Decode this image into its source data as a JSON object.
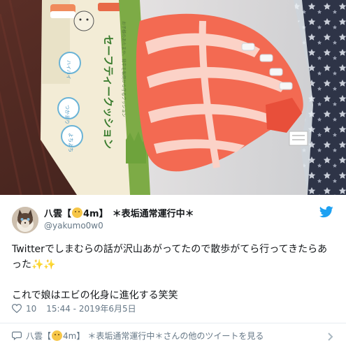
{
  "tweet": {
    "author_name_prefix": "八雲【",
    "author_name_mid": "4m】",
    "author_name_suffix": "＊表垢通常運行中＊",
    "author_handle": "@yakumo0w0",
    "body_line1": "Twitterでしまむらの話が沢山あがってたので散歩がてら行ってきたらあった",
    "body_sparkles": "✨✨",
    "body_line2": "これで娘はエビの化身に進化する笑笑",
    "likes": "10",
    "timestamp": "15:44 - 2019年6月5日",
    "footer_link": "さんの他のツイートを見る"
  },
  "photo": {
    "package_text_main": "セーフティークッション",
    "package_text_sub": "お子様のあたまや、背中を転倒から守るクッション",
    "badges": [
      "ハイハイ時期",
      "つかまり立ち時期",
      "よちよち歩き時期"
    ]
  },
  "colors": {
    "twitter_blue": "#1da1f2",
    "text": "#14171a",
    "secondary": "#657786",
    "shrimp": "#f0604a",
    "package_green": "#6ea33c"
  },
  "icons": [
    "twitter-bird-icon",
    "heart-icon",
    "reply-bubble-icon",
    "chevron-right-icon"
  ]
}
